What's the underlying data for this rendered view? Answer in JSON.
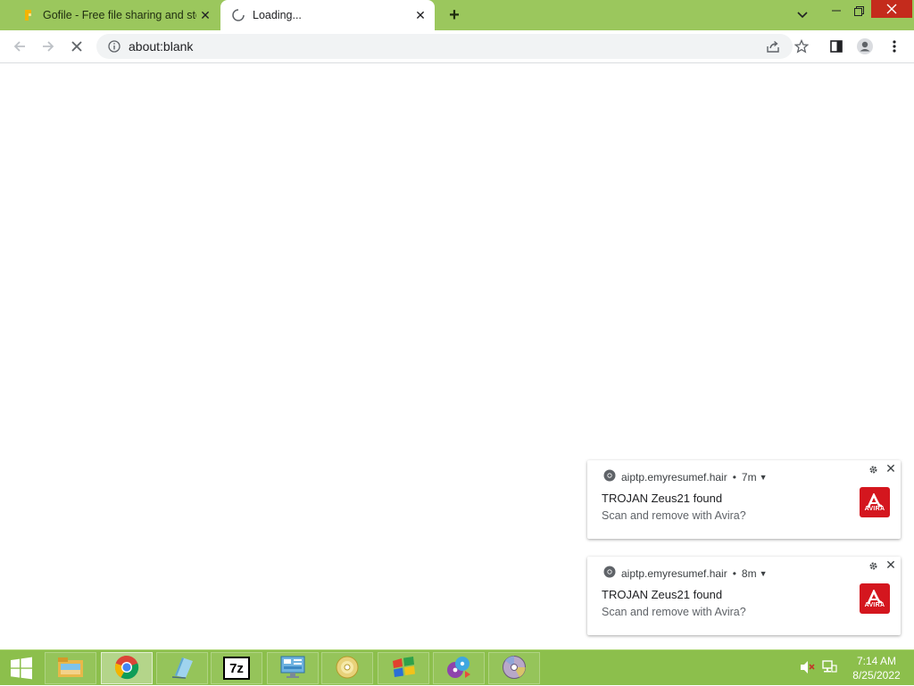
{
  "browser": {
    "tabs": [
      {
        "title": "Gofile - Free file sharing and storage",
        "favicon": "gofile-icon",
        "active": false
      },
      {
        "title": "Loading...",
        "favicon": "loading-spinner-icon",
        "active": true
      }
    ],
    "new_tab_label": "+",
    "address": "about:blank",
    "colors": {
      "frame": "#9bc75d",
      "toolbar": "#ffffff",
      "omnibox": "#f1f3f4"
    }
  },
  "notifications": [
    {
      "site": "aiptp.emyresumef.hair",
      "age": "7m",
      "title": "TROJAN Zeus21 found",
      "body": "Scan and remove with Avira?",
      "logo_text": "AVIRA",
      "icon": "avira-logo"
    },
    {
      "site": "aiptp.emyresumef.hair",
      "age": "8m",
      "title": "TROJAN Zeus21 found",
      "body": "Scan and remove with Avira?",
      "logo_text": "AVIRA",
      "icon": "avira-logo"
    }
  ],
  "taskbar": {
    "apps": [
      {
        "name": "file-explorer-icon",
        "active": false
      },
      {
        "name": "chrome-icon",
        "active": true
      },
      {
        "name": "notepad-icon",
        "active": false
      },
      {
        "name": "7zip-icon",
        "active": false
      },
      {
        "name": "control-panel-icon",
        "active": false
      },
      {
        "name": "disc-burner-icon",
        "active": false
      },
      {
        "name": "windows-flag-icon",
        "active": false
      },
      {
        "name": "media-player-icon",
        "active": false
      },
      {
        "name": "dvd-icon",
        "active": false
      }
    ],
    "seven_zip_label": "7z",
    "time": "7:14 AM",
    "date": "8/25/2022",
    "color": "#8cbf4c"
  }
}
